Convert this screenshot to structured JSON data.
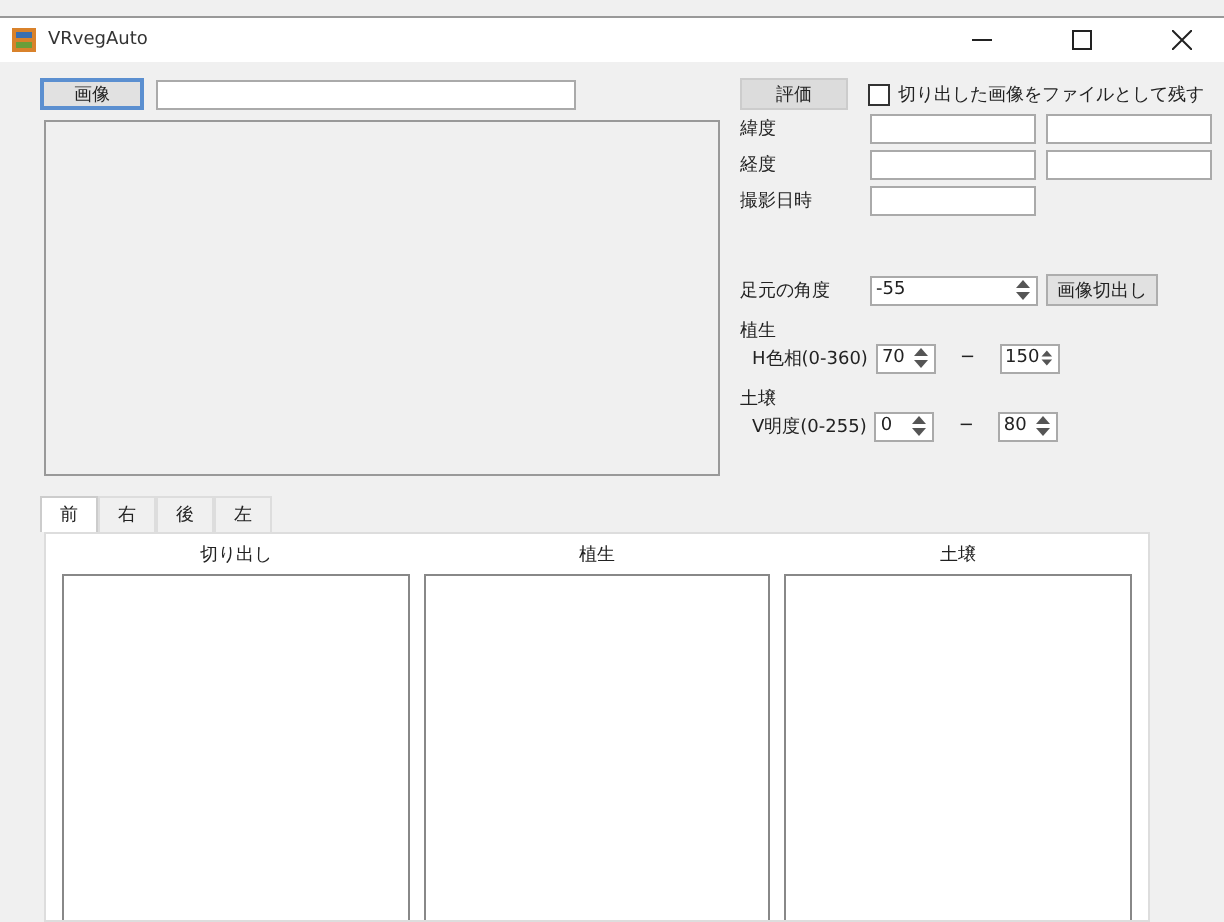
{
  "window": {
    "title": "VRvegAuto"
  },
  "image_button": "画像",
  "evaluate_button": "評価",
  "save_checkbox": {
    "label": "切り出した画像をファイルとして残す",
    "checked": false
  },
  "fields": [
    {
      "label": "緯度",
      "kind": "pair"
    },
    {
      "label": "経度",
      "kind": "pair"
    },
    {
      "label": "撮影日時",
      "kind": "single"
    }
  ],
  "angle": {
    "label": "足元の角度",
    "value": "-55"
  },
  "crop_button": "画像切出し",
  "ranges": [
    {
      "group": "植生",
      "label": "H色相(0-360)",
      "min": "70",
      "dash": "−",
      "max": "150"
    },
    {
      "group": "土壌",
      "label": "V明度(0-255)",
      "min": "0",
      "dash": "−",
      "max": "80"
    }
  ],
  "tabs": [
    {
      "label": "前",
      "selected": true
    },
    {
      "label": "右",
      "selected": false
    },
    {
      "label": "後",
      "selected": false
    },
    {
      "label": "左",
      "selected": false
    }
  ],
  "panels": [
    "切り出し",
    "植生",
    "土壌"
  ]
}
